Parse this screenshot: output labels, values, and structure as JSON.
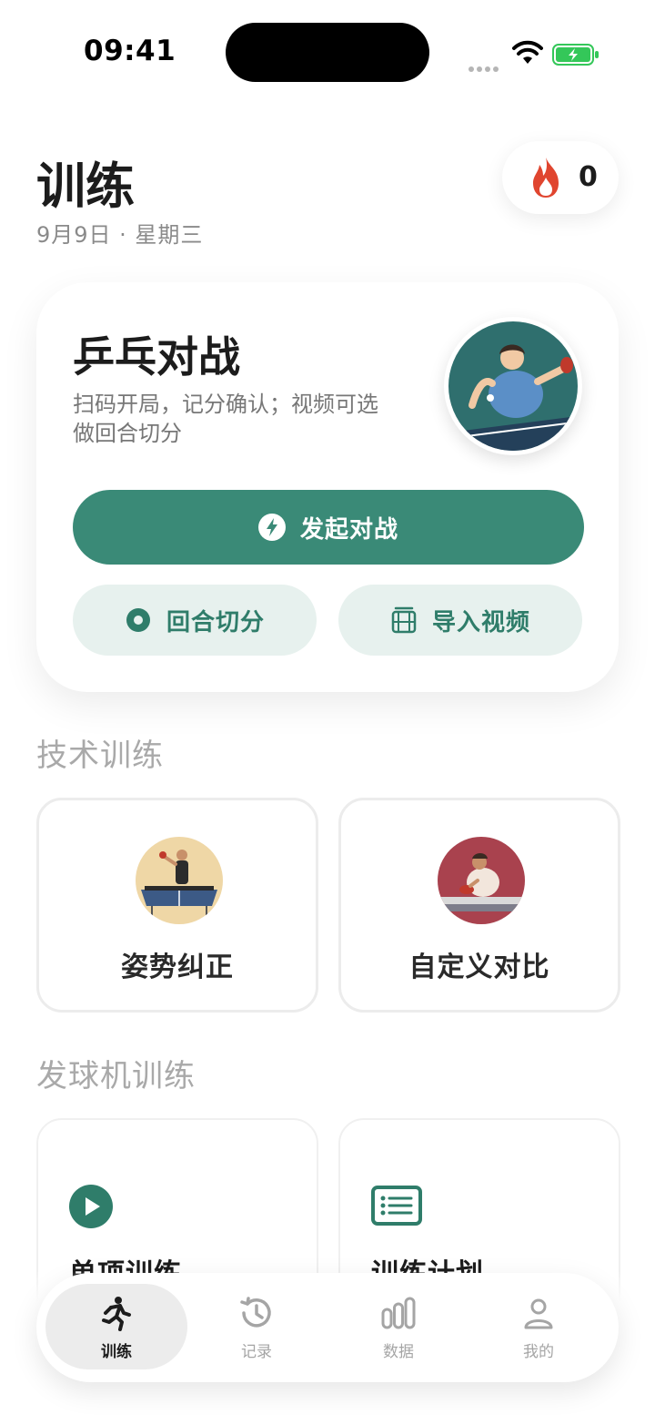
{
  "status_bar": {
    "time": "09:41"
  },
  "header": {
    "title": "训练",
    "date": "9月9日 · 星期三",
    "streak_count": "0"
  },
  "match_card": {
    "title": "乒乓对战",
    "description": "扫码开局，记分确认；视频可选做回合切分",
    "start_label": "发起对战",
    "rally_label": "回合切分",
    "import_label": "导入视频"
  },
  "tech_section": {
    "title": "技术训练",
    "items": [
      {
        "label": "姿势纠正"
      },
      {
        "label": "自定义对比"
      }
    ]
  },
  "machine_section": {
    "title": "发球机训练",
    "items": [
      {
        "label": "单项训练"
      },
      {
        "label": "训练计划"
      }
    ]
  },
  "tab_bar": {
    "tabs": [
      {
        "label": "训练",
        "icon": "runner-icon",
        "active": true
      },
      {
        "label": "记录",
        "icon": "history-icon",
        "active": false
      },
      {
        "label": "数据",
        "icon": "bar-chart-icon",
        "active": false
      },
      {
        "label": "我的",
        "icon": "person-icon",
        "active": false
      }
    ]
  },
  "colors": {
    "primary": "#3a8a77",
    "primary_light": "#e7f1ee",
    "streak_flame": "#e0452f"
  },
  "icons": {
    "streak": "flame-icon",
    "start": "bolt-icon",
    "rally": "record-dot-icon",
    "import": "film-icon",
    "single": "play-icon",
    "plan": "list-icon"
  }
}
